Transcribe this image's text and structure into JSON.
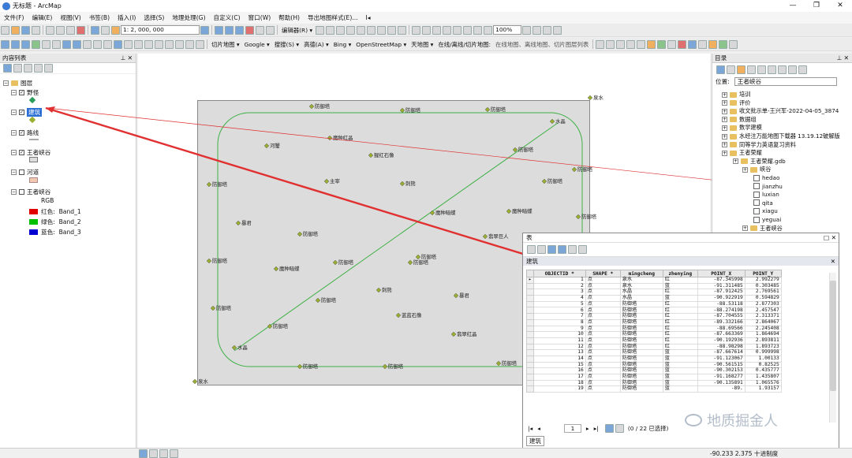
{
  "window": {
    "title": "无标题 - ArcMap",
    "controls": [
      "—",
      "❐",
      "✕"
    ]
  },
  "menu": [
    "文件(F)",
    "编辑(E)",
    "视图(V)",
    "书签(B)",
    "插入(I)",
    "选择(S)",
    "地理处理(G)",
    "自定义(C)",
    "窗口(W)",
    "帮助(H)",
    "导出地图样式(E)...",
    "I◂"
  ],
  "toolbar2": {
    "scale": "1: 2, 000, 000",
    "editor": "编辑器(R) ▾",
    "zoom": "100%"
  },
  "toolbar3": {
    "tile_map": "切片地图 ▾",
    "google": "Google ▾",
    "search": "搜搜(S) ▾",
    "gaode": "高德(A) ▾",
    "bing": "Bing ▾",
    "osm": "OpenStreetMap ▾",
    "tianditu": "天地图 ▾",
    "online": "在线/离线/切片地图:",
    "online_hint": "在线地图、离线地图、切片图层列表"
  },
  "toc": {
    "title": "内容列表",
    "layers_root": "图层",
    "items": [
      {
        "name": "野怪",
        "checked": true
      },
      {
        "name": "建筑",
        "checked": true,
        "selected": true
      },
      {
        "name": "路线",
        "checked": true
      },
      {
        "name": "王者峡谷",
        "checked": true
      },
      {
        "name": "河道",
        "checked": false
      },
      {
        "name": "王者峡谷",
        "checked": false
      }
    ],
    "rgb": "RGB",
    "bands": [
      {
        "label": "红色:",
        "band": "Band_1",
        "color": "#e00000"
      },
      {
        "label": "绿色:",
        "band": "Band_2",
        "color": "#00c000"
      },
      {
        "label": "蓝色:",
        "band": "Band_3",
        "color": "#0000d0"
      }
    ]
  },
  "map": {
    "labels": [
      {
        "text": "防御塔"
      },
      {
        "text": "防御塔"
      },
      {
        "text": "防御塔"
      },
      {
        "text": "泉水"
      },
      {
        "text": "水晶"
      },
      {
        "text": "魔种红晶"
      },
      {
        "text": "河蟹"
      },
      {
        "text": "猩红石像"
      },
      {
        "text": "防御塔"
      },
      {
        "text": "防御塔"
      },
      {
        "text": "主宰"
      },
      {
        "text": "刺熊"
      },
      {
        "text": "防御塔"
      },
      {
        "text": "防御塔"
      },
      {
        "text": "魔种暗蝶"
      },
      {
        "text": "防御塔"
      },
      {
        "text": "魔种暗蝶"
      },
      {
        "text": "暴君"
      },
      {
        "text": "防御塔"
      },
      {
        "text": "翡翠巨人"
      },
      {
        "text": "防御塔"
      },
      {
        "text": "防御塔"
      },
      {
        "text": "魔种暗蝶"
      },
      {
        "text": "防御塔"
      },
      {
        "text": "防御塔"
      },
      {
        "text": "闪蓝蜂蜂"
      },
      {
        "text": "刺熊"
      },
      {
        "text": "防御塔"
      },
      {
        "text": "防御塔"
      },
      {
        "text": "蓝蓝石像"
      },
      {
        "text": "暴君"
      },
      {
        "text": "防御塔"
      },
      {
        "text": "翡翠红晶"
      },
      {
        "text": "水晶"
      },
      {
        "text": "防御塔"
      },
      {
        "text": "防御塔"
      },
      {
        "text": "防御塔"
      },
      {
        "text": "泉水"
      }
    ]
  },
  "catalog": {
    "title": "目录",
    "location_label": "位置:",
    "location": "王者峡谷",
    "tree": [
      {
        "text": "培训"
      },
      {
        "text": "评价"
      },
      {
        "text": "收文批示单-王兴军-2022-04-05_3874"
      },
      {
        "text": "数据组"
      },
      {
        "text": "数学建模"
      },
      {
        "text": "水经注万能地图下载器 13.19.12破解版"
      },
      {
        "text": "同等学力英语复习资料"
      },
      {
        "text": "王者荣耀"
      },
      {
        "text": "王者荣耀.gdb"
      },
      {
        "text": "峡谷"
      },
      {
        "text": "hedao"
      },
      {
        "text": "jianzhu"
      },
      {
        "text": "luxian"
      },
      {
        "text": "qita"
      },
      {
        "text": "xiagu"
      },
      {
        "text": "yeguai"
      },
      {
        "text": "王者峡谷"
      }
    ]
  },
  "table": {
    "window_title": "表",
    "name": "建筑",
    "columns": [
      "OBJECTID *",
      "SHAPE *",
      "mingcheng",
      "zhenying",
      "POINT_X",
      "POINT_Y"
    ],
    "rows": [
      [
        "1",
        "点",
        "泉水",
        "红",
        "-87.345998",
        "2.992279"
      ],
      [
        "2",
        "点",
        "泉水",
        "蓝",
        "-91.311485",
        "0.303485"
      ],
      [
        "3",
        "点",
        "水晶",
        "红",
        "-87.912425",
        "2.769561"
      ],
      [
        "4",
        "点",
        "水晶",
        "蓝",
        "-90.922919",
        "0.594829"
      ],
      [
        "5",
        "点",
        "防御塔",
        "红",
        "-88.53118",
        "2.877303"
      ],
      [
        "6",
        "点",
        "防御塔",
        "红",
        "-88.274198",
        "2.457547"
      ],
      [
        "7",
        "点",
        "防御塔",
        "红",
        "-87.704555",
        "2.313371"
      ],
      [
        "8",
        "点",
        "防御塔",
        "红",
        "-89.332166",
        "2.864067"
      ],
      [
        "9",
        "点",
        "防御塔",
        "红",
        "-88.69566",
        "2.245408"
      ],
      [
        "10",
        "点",
        "防御塔",
        "红",
        "-87.663369",
        "1.864694"
      ],
      [
        "11",
        "点",
        "防御塔",
        "红",
        "-90.192936",
        "2.893811"
      ],
      [
        "12",
        "点",
        "防御塔",
        "红",
        "-88.98298",
        "1.893723"
      ],
      [
        "13",
        "点",
        "防御塔",
        "蓝",
        "-87.667614",
        "0.999998"
      ],
      [
        "14",
        "点",
        "防御塔",
        "蓝",
        "-91.123067",
        "1.00133"
      ],
      [
        "15",
        "点",
        "防御塔",
        "蓝",
        "-90.561515",
        "0.82525"
      ],
      [
        "16",
        "点",
        "防御塔",
        "蓝",
        "-90.302153",
        "0.435777"
      ],
      [
        "17",
        "点",
        "防御塔",
        "蓝",
        "-91.168277",
        "1.435807"
      ],
      [
        "18",
        "点",
        "防御塔",
        "蓝",
        "-90.135891",
        "1.065576"
      ],
      [
        "19",
        "点",
        "防御塔",
        "蓝",
        "-89.",
        "1.93157"
      ]
    ],
    "page": "1",
    "selection": "(0 / 22 已选择)"
  },
  "status": {
    "coords": "-90.233  2.375 十进制度"
  },
  "watermark": "地质掘金人"
}
